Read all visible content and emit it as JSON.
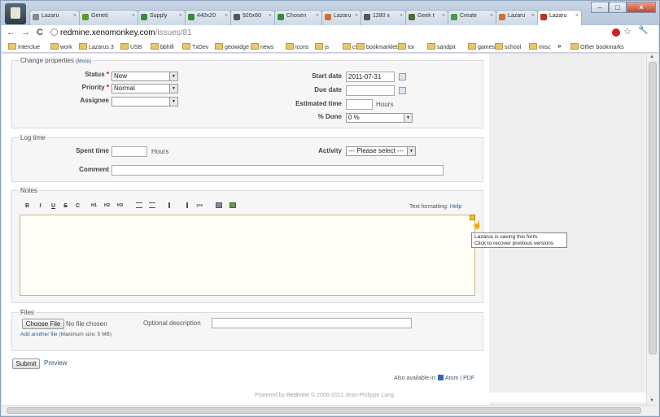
{
  "browser": {
    "tabs": [
      {
        "label": "Lazaru",
        "icon": "wrench-icon",
        "color": "#888888"
      },
      {
        "label": "Geneti",
        "icon": "plant-icon",
        "color": "#5a9a2a"
      },
      {
        "label": "Supply",
        "icon": "puzzle-icon",
        "color": "#3a8a3a"
      },
      {
        "label": "440x20",
        "icon": "puzzle-icon",
        "color": "#3a8a3a"
      },
      {
        "label": "920x60",
        "icon": "globe-icon",
        "color": "#555555"
      },
      {
        "label": "Chosen",
        "icon": "puzzle-icon",
        "color": "#3a8a3a"
      },
      {
        "label": "Lazaru",
        "icon": "lazarus-icon",
        "color": "#d07030"
      },
      {
        "label": "1280 x",
        "icon": "globe-icon",
        "color": "#555555"
      },
      {
        "label": "Geek t",
        "icon": "geek-icon",
        "color": "#4a6a3a"
      },
      {
        "label": "Create",
        "icon": "create-icon",
        "color": "#4a9a4a"
      },
      {
        "label": "Lazaru",
        "icon": "lazarus-icon",
        "color": "#d07030"
      },
      {
        "label": "Lazaru",
        "icon": "lazarus-arch-icon",
        "color": "#c03020"
      }
    ],
    "address": {
      "host": "redmine.xenomonkey.com",
      "path": "/issues/81"
    },
    "bookmarks": [
      "Interclue",
      "work",
      "Lazarus 3",
      "USB",
      "bbhifi",
      "TxDev",
      "geowidge",
      "news",
      "icons",
      "js",
      "css",
      "bookmarklets",
      "tor",
      "sandpit",
      "games",
      "school",
      "misc",
      "»",
      "Other bookmarks"
    ]
  },
  "properties": {
    "legend": "Change properties",
    "more_link": "(More)",
    "status_label": "Status",
    "status_value": "New",
    "priority_label": "Priority",
    "priority_value": "Normal",
    "assignee_label": "Assignee",
    "assignee_value": "",
    "required_mark": "*",
    "start_date_label": "Start date",
    "start_date_value": "2011-07-31",
    "due_date_label": "Due date",
    "due_date_value": "",
    "estimated_label": "Estimated time",
    "estimated_value": "",
    "hours_unit": "Hours",
    "done_label": "% Done",
    "done_value": "0 %"
  },
  "logtime": {
    "legend": "Log time",
    "spent_label": "Spent time",
    "spent_value": "",
    "hours_unit": "Hours",
    "activity_label": "Activity",
    "activity_value": "--- Please select ---",
    "comment_label": "Comment",
    "comment_value": ""
  },
  "notes": {
    "legend": "Notes",
    "toolbar": [
      "B",
      "I",
      "U",
      "S",
      "C",
      "H1",
      "H2",
      "H3",
      "ul",
      "ol",
      "»",
      "«",
      "pre",
      "img",
      "link"
    ],
    "formatting_label": "Text formatting:",
    "help_link": "Help",
    "text": "",
    "tooltip_line1": "Lazarus is saving this form.",
    "tooltip_line2": "Click to recover previous versions"
  },
  "files": {
    "legend": "Files",
    "choose_button": "Choose File",
    "no_file": "No file chosen",
    "optional_label": "Optional description",
    "add_another": "Add another file",
    "max_size": "(Maximum size: 5 MB)"
  },
  "actions": {
    "submit": "Submit",
    "preview": "Preview",
    "also_available": "Also available in:",
    "atom": "Atom",
    "separator": "|",
    "pdf": "PDF"
  },
  "footer": {
    "powered_by": "Powered by",
    "redmine": "Redmine",
    "copyright": "© 2006-2011 Jean-Philippe Lang"
  }
}
